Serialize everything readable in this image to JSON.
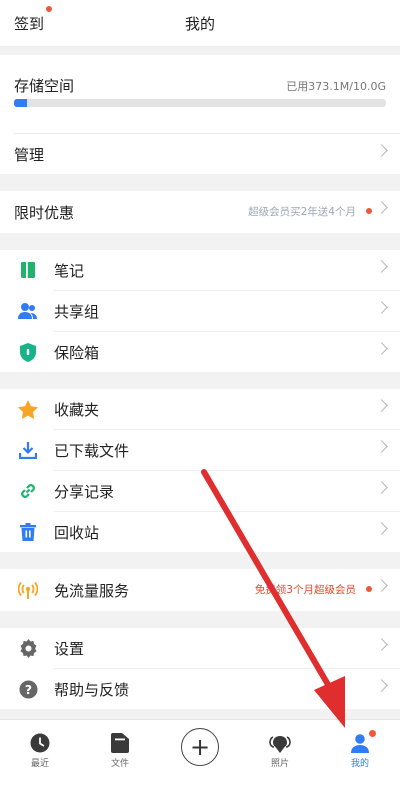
{
  "header": {
    "checkin": "签到",
    "title": "我的"
  },
  "storage": {
    "title": "存储空间",
    "used": "已用373.1M/10.0G",
    "fraction": 0.036
  },
  "manage": {
    "label": "管理"
  },
  "promo_row": {
    "label": "限时优惠",
    "note": "超级会员买2年送4个月"
  },
  "group1": [
    {
      "label": "笔记",
      "icon": "note-icon",
      "color": "#1fb36b"
    },
    {
      "label": "共享组",
      "icon": "group-icon",
      "color": "#2f7cf6"
    },
    {
      "label": "保险箱",
      "icon": "shield-icon",
      "color": "#19b38a"
    }
  ],
  "group2": [
    {
      "label": "收藏夹",
      "icon": "star-icon",
      "color": "#f6a623"
    },
    {
      "label": "已下载文件",
      "icon": "download-icon",
      "color": "#2f7cf6"
    },
    {
      "label": "分享记录",
      "icon": "link-icon",
      "color": "#1fb36b"
    },
    {
      "label": "回收站",
      "icon": "trash-icon",
      "color": "#2f7cf6"
    }
  ],
  "traffic_row": {
    "label": "免流量服务",
    "note": "免费领3个月超级会员",
    "icon": "signal-icon",
    "color": "#f6a623"
  },
  "group3": [
    {
      "label": "设置",
      "icon": "gear-icon",
      "color": "#666666"
    },
    {
      "label": "帮助与反馈",
      "icon": "help-icon",
      "color": "#666666"
    }
  ],
  "tabbar": {
    "recent": "最近",
    "files": "文件",
    "add_icon": "plus-icon",
    "photos": "照片",
    "mine": "我的"
  },
  "colors": {
    "accent": "#2f7cf6",
    "badge": "#f0563a",
    "arrow": "#e02d2d"
  }
}
